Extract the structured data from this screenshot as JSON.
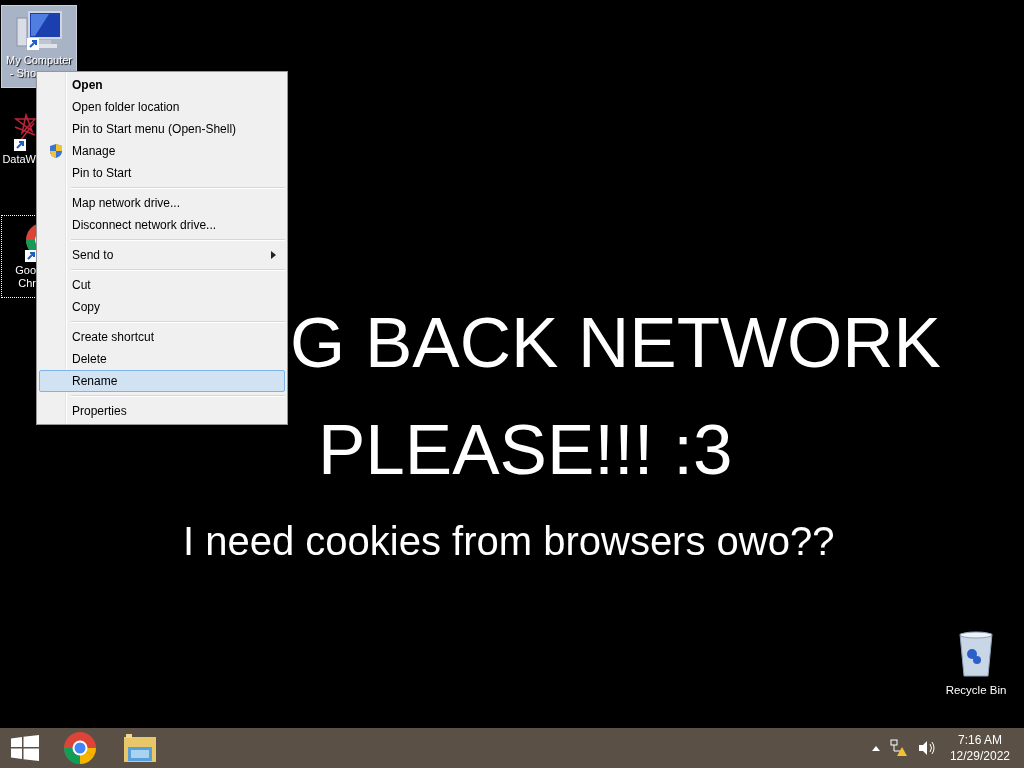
{
  "desktop": {
    "wallpaper_lines": [
      "G BACK NETWORK",
      "PLEASE!!! :3",
      "I need cookies from browsers owo??"
    ],
    "shortcuts": [
      {
        "kind": "computer",
        "label": [
          "My Computer",
          "- Sho"
        ],
        "selected": true,
        "focused": false
      },
      {
        "kind": "datawrapper",
        "label": [
          "DataW"
        ],
        "selected": false,
        "focused": false
      },
      {
        "kind": "chrome",
        "label": [
          "Goo",
          "Chr"
        ],
        "selected": false,
        "focused": true
      }
    ],
    "recycle_bin": {
      "label": "Recycle Bin"
    }
  },
  "context_menu": {
    "items": [
      {
        "kind": "item",
        "label": "Open",
        "bold": true,
        "selected": false
      },
      {
        "kind": "item",
        "label": "Open folder location",
        "selected": false
      },
      {
        "kind": "item",
        "label": "Pin to Start menu (Open-Shell)",
        "selected": false
      },
      {
        "kind": "shield",
        "label": "Manage",
        "selected": false
      },
      {
        "kind": "item",
        "label": "Pin to Start",
        "selected": false
      },
      {
        "kind": "separator"
      },
      {
        "kind": "item",
        "label": "Map network drive...",
        "selected": false
      },
      {
        "kind": "item",
        "label": "Disconnect network drive...",
        "selected": false
      },
      {
        "kind": "separator"
      },
      {
        "kind": "item",
        "label": "Send to",
        "submenu": true,
        "selected": false
      },
      {
        "kind": "separator"
      },
      {
        "kind": "item",
        "label": "Cut",
        "selected": false
      },
      {
        "kind": "item",
        "label": "Copy",
        "selected": false
      },
      {
        "kind": "separator"
      },
      {
        "kind": "item",
        "label": "Create shortcut",
        "selected": false
      },
      {
        "kind": "item",
        "label": "Delete",
        "selected": false
      },
      {
        "kind": "item",
        "label": "Rename",
        "selected": true
      },
      {
        "kind": "separator"
      },
      {
        "kind": "item",
        "label": "Properties",
        "selected": false
      }
    ]
  },
  "taskbar": {
    "apps": [
      {
        "kind": "start"
      },
      {
        "kind": "chrome"
      },
      {
        "kind": "explorer"
      }
    ],
    "tray": {
      "time": "7:16 AM",
      "date": "12/29/2022"
    }
  }
}
